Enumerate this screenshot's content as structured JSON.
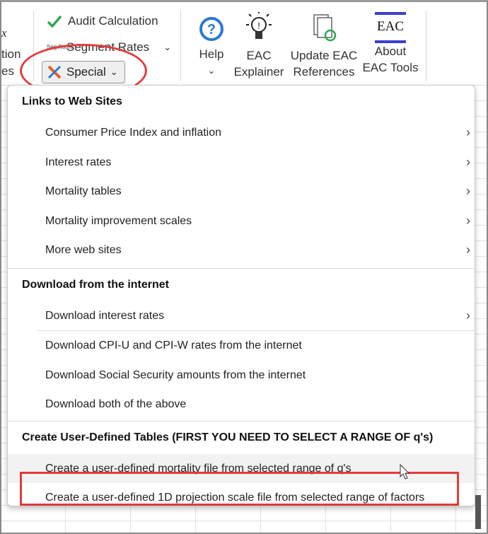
{
  "ribbon": {
    "left_partial": [
      "x",
      "tion",
      "es"
    ],
    "audit": "Audit Calculation",
    "segment": "Segment Rates",
    "segment_icon_text": "Seg Rates",
    "special": "Special",
    "help": "Help",
    "explainer": [
      "EAC",
      "Explainer"
    ],
    "update": [
      "Update EAC",
      "References"
    ],
    "about": [
      "About",
      "EAC Tools"
    ],
    "eac_logo": "EAC"
  },
  "menu": {
    "sections": [
      {
        "header": "Links to Web Sites",
        "items": [
          {
            "label": "Consumer Price Index and inflation",
            "submenu": true
          },
          {
            "label": "Interest rates",
            "submenu": true
          },
          {
            "label": "Mortality tables",
            "submenu": true
          },
          {
            "label": "Mortality improvement scales",
            "submenu": true
          },
          {
            "label": "More web sites",
            "submenu": true
          }
        ]
      },
      {
        "header": "Download from the internet",
        "items": [
          {
            "label": "Download interest rates",
            "submenu": true
          },
          {
            "label": "Download CPI-U and CPI-W rates from the internet"
          },
          {
            "label": "Download Social Security amounts from the internet"
          },
          {
            "label": "Download both of the above"
          }
        ]
      },
      {
        "header": "Create User-Defined Tables (FIRST YOU NEED TO SELECT A RANGE OF q's)",
        "items": [
          {
            "label": "Create a user-defined mortality file from selected range of q's",
            "hovered": true
          },
          {
            "label": "Create a user-defined 1D projection scale file from selected range of factors",
            "highlighted": true
          }
        ]
      }
    ]
  },
  "colors": {
    "annotation": "#e23b3b",
    "check": "#2fa84f",
    "help": "#2a78d6",
    "eac_bar": "#3a3fd0"
  }
}
